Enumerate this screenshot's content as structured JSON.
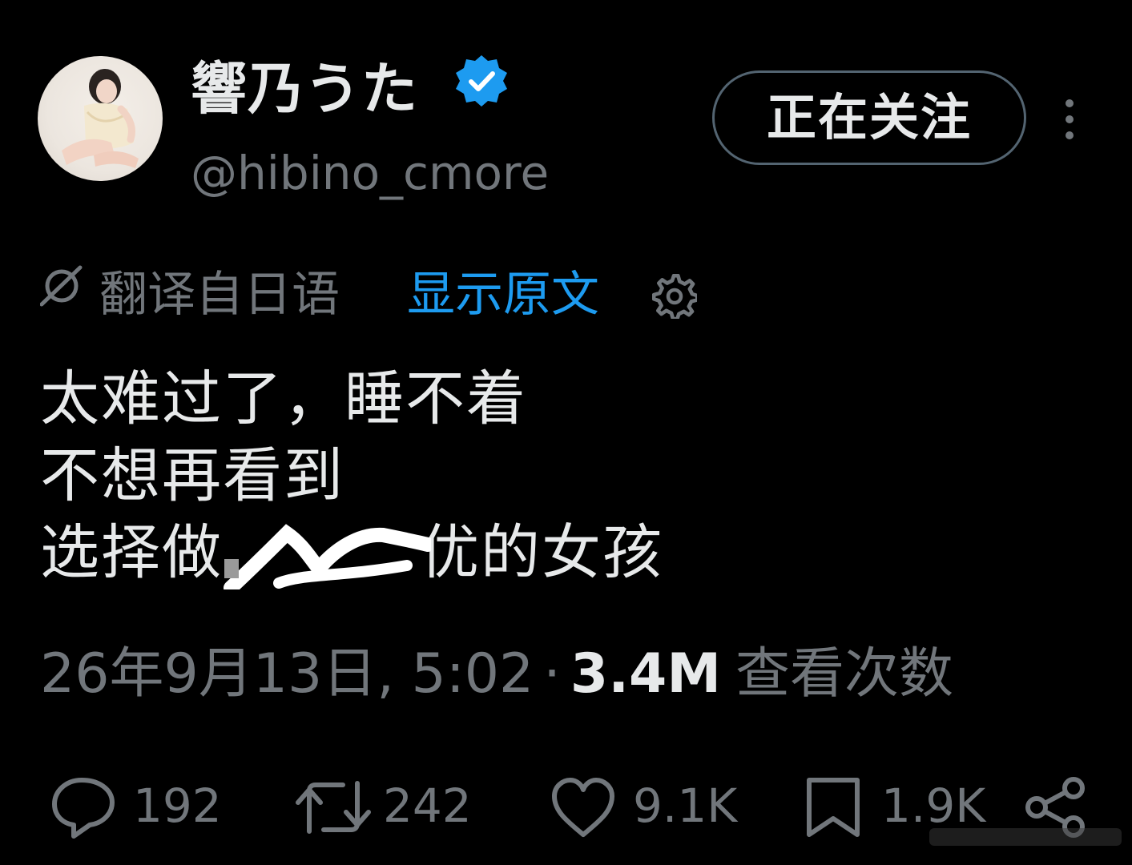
{
  "author": {
    "display_name": "響乃うた",
    "handle": "@hibino_cmore",
    "verified": true
  },
  "follow_button": {
    "label": "正在关注"
  },
  "translation": {
    "label": "翻译自日语",
    "show_original_label": "显示原文"
  },
  "tweet": {
    "lines": [
      "太难过了，睡不着",
      "不想再看到",
      "选择做",
      "优的女孩"
    ]
  },
  "meta": {
    "date": "26年9月13日, 5:02",
    "separator": "·",
    "views": "3.4M",
    "views_label": "查看次数"
  },
  "actions": {
    "replies": "192",
    "reposts": "242",
    "likes": "9.1K",
    "bookmarks": "1.9K"
  },
  "icons": {
    "verified": "verified-badge-icon",
    "more": "more-vertical-icon",
    "translate": "translate-icon",
    "settings": "gear-icon",
    "reply": "reply-icon",
    "repost": "repost-icon",
    "like": "heart-icon",
    "bookmark": "bookmark-icon",
    "share": "share-icon"
  },
  "colors": {
    "background": "#000000",
    "text_primary": "#e7e9ea",
    "text_secondary": "#71767b",
    "accent": "#1d9bf0",
    "button_border": "#536471"
  }
}
